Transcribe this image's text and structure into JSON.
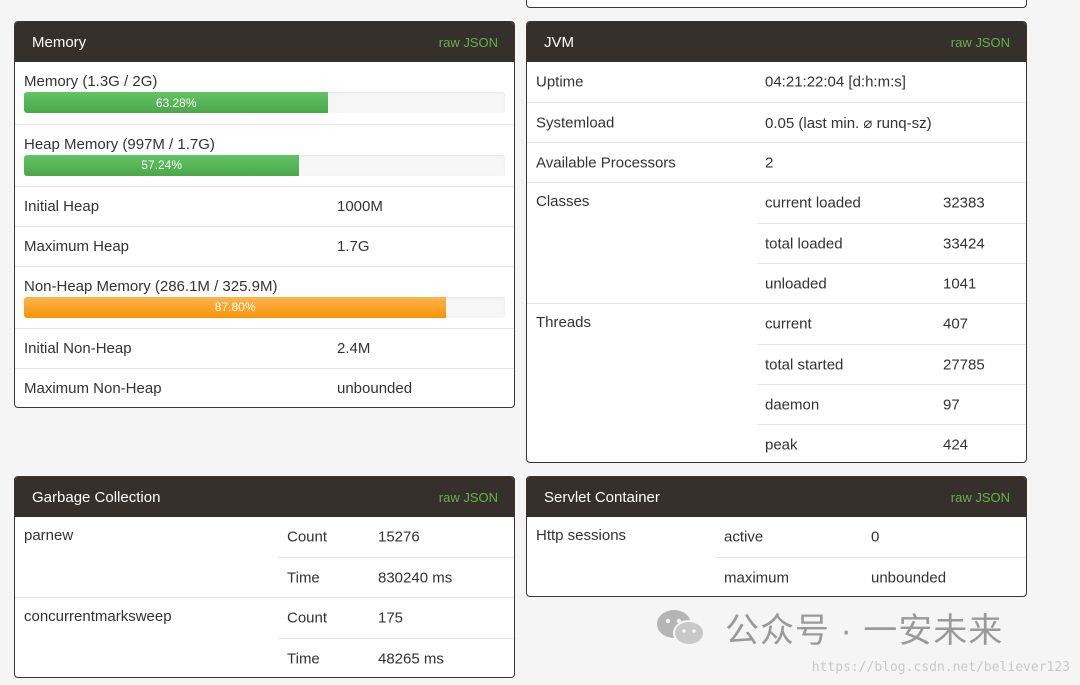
{
  "memory": {
    "title": "Memory",
    "raw": "raw JSON",
    "mem_label": "Memory (1.3G / 2G)",
    "mem_pct": "63.28%",
    "mem_fraction": 0.6328,
    "heap_label": "Heap Memory (997M / 1.7G)",
    "heap_pct": "57.24%",
    "heap_fraction": 0.5724,
    "init_heap_label": "Initial Heap",
    "init_heap_value": "1000M",
    "max_heap_label": "Maximum Heap",
    "max_heap_value": "1.7G",
    "nonheap_label": "Non-Heap Memory (286.1M / 325.9M)",
    "nonheap_pct": "87.80%",
    "nonheap_fraction": 0.878,
    "init_nonheap_label": "Initial Non-Heap",
    "init_nonheap_value": "2.4M",
    "max_nonheap_label": "Maximum Non-Heap",
    "max_nonheap_value": "unbounded"
  },
  "jvm": {
    "title": "JVM",
    "raw": "raw JSON",
    "uptime_label": "Uptime",
    "uptime_value": "04:21:22:04 [d:h:m:s]",
    "sysload_label": "Systemload",
    "sysload_value": "0.05 (last min. ⌀ runq-sz)",
    "proc_label": "Available Processors",
    "proc_value": "2",
    "classes_label": "Classes",
    "classes": [
      {
        "k": "current loaded",
        "v": "32383"
      },
      {
        "k": "total loaded",
        "v": "33424"
      },
      {
        "k": "unloaded",
        "v": "1041"
      }
    ],
    "threads_label": "Threads",
    "threads": [
      {
        "k": "current",
        "v": "407"
      },
      {
        "k": "total started",
        "v": "27785"
      },
      {
        "k": "daemon",
        "v": "97"
      },
      {
        "k": "peak",
        "v": "424"
      }
    ]
  },
  "gc": {
    "title": "Garbage Collection",
    "raw": "raw JSON",
    "collectors": [
      {
        "name": "parnew",
        "count_label": "Count",
        "count": "15276",
        "time_label": "Time",
        "time": "830240 ms"
      },
      {
        "name": "concurrentmarksweep",
        "count_label": "Count",
        "count": "175",
        "time_label": "Time",
        "time": "48265 ms"
      }
    ]
  },
  "servlet": {
    "title": "Servlet Container",
    "raw": "raw JSON",
    "sessions_label": "Http sessions",
    "active_label": "active",
    "active_value": "0",
    "max_label": "maximum",
    "max_value": "unbounded"
  },
  "watermark": {
    "text": "公众号 · 一安未来",
    "credit": "https://blog.csdn.net/believer123"
  },
  "colors": {
    "header_bg": "#35302b",
    "raw_link": "#61b346",
    "bar_green": "#5cb85c",
    "bar_orange": "#f89406"
  }
}
